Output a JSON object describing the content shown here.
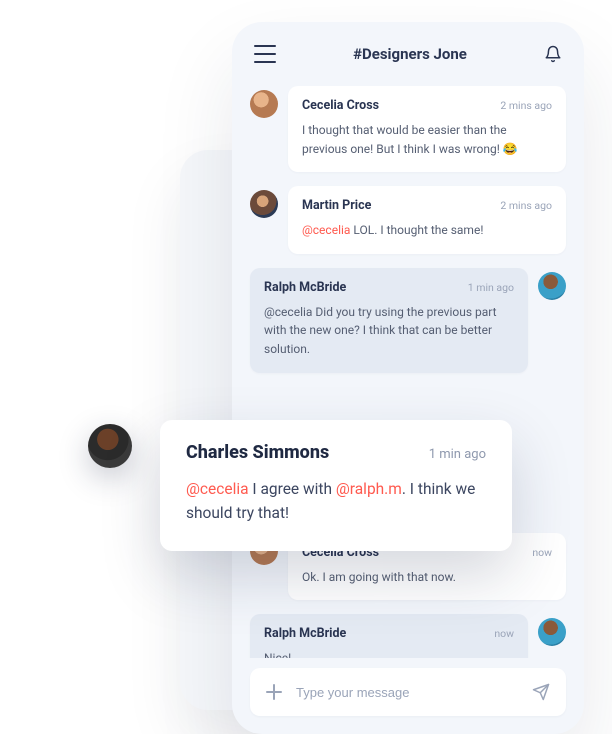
{
  "header": {
    "channel": "#Designers Jone"
  },
  "composer": {
    "placeholder": "Type your message"
  },
  "messages": [
    {
      "side": "left",
      "avatar": "av1",
      "author": "Cecelia Cross",
      "time": "2 mins ago",
      "segments": [
        {
          "t": "I thought that would be easier than the previous one! But I think I was wrong! 😂"
        }
      ]
    },
    {
      "side": "left",
      "avatar": "av2",
      "author": "Martin Price",
      "time": "2 mins ago",
      "segments": [
        {
          "t": "@cecelia",
          "m": true
        },
        {
          "t": " LOL. I thought the same!"
        }
      ]
    },
    {
      "side": "right",
      "avatar": "av3",
      "alt": true,
      "author": "Ralph McBride",
      "time": "1 min ago",
      "segments": [
        {
          "t": "@cecelia Did you try using the previous part with the new one? I think that can be better solution."
        }
      ]
    },
    {
      "spacer": true
    },
    {
      "side": "left",
      "avatar": "av1",
      "author": "Cecelia Cross",
      "time": "now",
      "segments": [
        {
          "t": "Ok. I am going with that now."
        }
      ]
    },
    {
      "side": "right",
      "avatar": "av3",
      "alt": true,
      "author": "Ralph McBride",
      "time": "now",
      "segments": [
        {
          "t": "Nice!"
        }
      ]
    }
  ],
  "popout": {
    "avatar": "av4",
    "author": "Charles Simmons",
    "time": "1 min ago",
    "segments": [
      {
        "t": "@cecelia",
        "m": true
      },
      {
        "t": " I agree with "
      },
      {
        "t": "@ralph.m",
        "m": true
      },
      {
        "t": ". I think we should try that!"
      }
    ]
  }
}
